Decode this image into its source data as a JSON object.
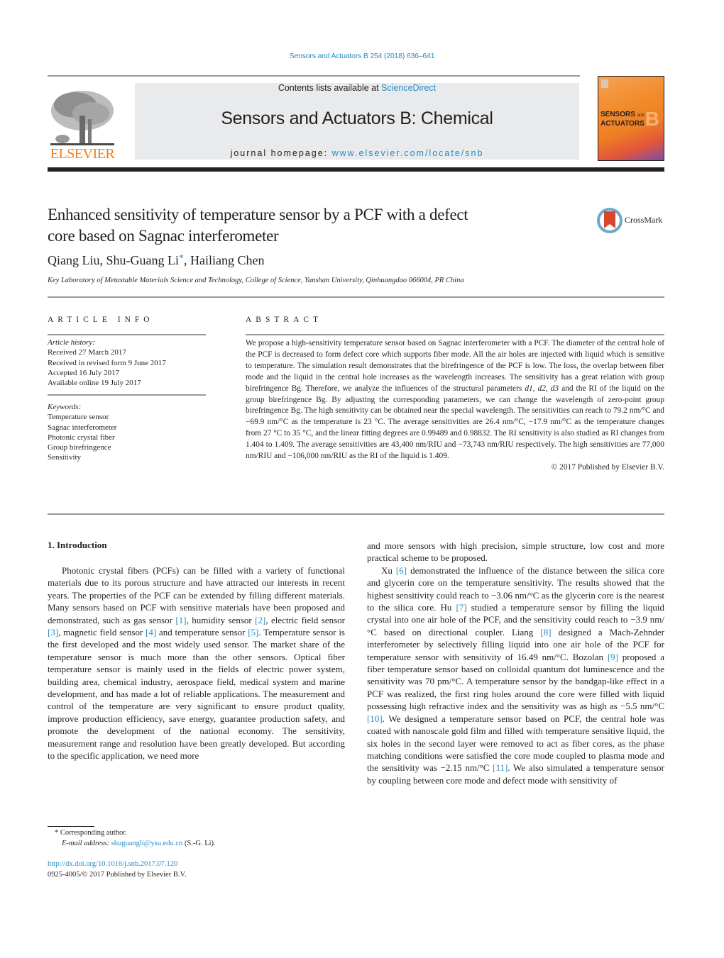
{
  "header": {
    "citation": "Sensors and Actuators B 254 (2018) 636–641",
    "contents_prefix": "Contents lists available at ",
    "contents_link": "ScienceDirect",
    "journal_title": "Sensors and Actuators B: Chemical",
    "homepage_prefix": "journal homepage: ",
    "homepage_link": "www.elsevier.com/locate/snb",
    "publisher_logo_text": "ELSEVIER",
    "cover": {
      "line1": "SENSORS",
      "and": "and",
      "line2": "ACTUATORS",
      "letter": "B"
    },
    "colors": {
      "link": "#2a8cc3",
      "elsevier_orange": "#f07d1a",
      "masthead_bg": "#e9eaeb"
    }
  },
  "article": {
    "title_line1": "Enhanced sensitivity of temperature sensor by a PCF with a defect",
    "title_line2": "core based on Sagnac interferometer",
    "crossmark_label": "CrossMark",
    "authors": {
      "a1": "Qiang Liu, Shu-Guang Li",
      "star": "*",
      "a2": ", Hailiang Chen"
    },
    "affiliation": "Key Laboratory of Metastable Materials Science and Technology, College of Science, Yanshan University, Qinhuangdao 066004, PR China"
  },
  "article_info": {
    "heading": "ARTICLE INFO",
    "history_label": "Article history:",
    "history": [
      "Received 27 March 2017",
      "Received in revised form 9 June 2017",
      "Accepted 16 July 2017",
      "Available online 19 July 2017"
    ],
    "keywords_label": "Keywords:",
    "keywords": [
      "Temperature sensor",
      "Sagnac interferometer",
      "Photonic crystal fiber",
      "Group birefringence",
      "Sensitivity"
    ]
  },
  "abstract": {
    "heading": "ABSTRACT",
    "text_a": "We propose a high-sensitivity temperature sensor based on Sagnac interferometer with a PCF. The diameter of the central hole of the PCF is decreased to form defect core which supports fiber mode. All the air holes are injected with liquid which is sensitive to temperature. The simulation result demonstrates that the birefringence of the PCF is low. The loss, the overlap between fiber mode and the liquid in the central hole increases as the wavelength increases. The sensitivity has a great relation with group birefringence Bg. Therefore, we analyze the influences of the structural parameters ",
    "vars": "d1, d2, d3",
    "text_b": " and the RI of the liquid on the group birefringence Bg. By adjusting the corresponding parameters, we can change the wavelength of zero-point group birefringence Bg. The high sensitivity can be obtained near the special wavelength. The sensitivities can reach to 79.2 nm/°C and −69.9 nm/°C as the temperature is 23 °C. The average sensitivities are 26.4 nm/°C, −17.9 nm/°C as the temperature changes from 27 °C to 35 °C, and the linear fitting degrees are 0.99489 and 0.98832. The RI sensitivity is also studied as RI changes from 1.404 to 1.409. The average sensitivities are 43,400 nm/RIU and −73,743 nm/RIU respectively. The high sensitivities are 77,000 nm/RIU and −106,000 nm/RIU as the RI of the liquid is 1.409.",
    "copyright": "© 2017 Published by Elsevier B.V."
  },
  "body": {
    "section_title": "1.  Introduction",
    "left": {
      "p1_a": "Photonic crystal fibers (PCFs) can be filled with a variety of functional materials due to its porous structure and have attracted our interests in recent years. The properties of the PCF can be extended by filling different materials. Many sensors based on PCF with sensitive materials have been proposed and demonstrated, such as gas sensor ",
      "r1": "[1]",
      "p1_b": ", humidity sensor ",
      "r2": "[2]",
      "p1_c": ", electric field sensor ",
      "r3": "[3]",
      "p1_d": ", magnetic field sensor ",
      "r4": "[4]",
      "p1_e": " and temperature sensor ",
      "r5": "[5]",
      "p1_f": ". Temperature sensor is the first developed and the most widely used sensor. The market share of the temperature sensor is much more than the other sensors. Optical fiber temperature sensor is mainly used in the fields of electric power system, building area, chemical industry, aerospace field, medical system and marine development, and has made a lot of reliable applications. The measurement and control of the temperature are very significant to ensure product quality, improve production efficiency, save energy, guarantee production safety, and promote the development of the national economy. The sensitivity, measurement range and resolution have been greatly developed. But according to the specific application, we need more"
    },
    "right": {
      "p1": "and more sensors with high precision, simple structure, low cost and more practical scheme to be proposed.",
      "p2_a": "Xu ",
      "r6": "[6]",
      "p2_b": " demonstrated the influence of the distance between the silica core and glycerin core on the temperature sensitivity. The results showed that the highest sensitivity could reach to −3.06 nm/°C as the glycerin core is the nearest to the silica core. Hu ",
      "r7": "[7]",
      "p2_c": " studied a temperature sensor by filling the liquid crystal into one air hole of the PCF, and the sensitivity could reach to −3.9 nm/°C based on directional coupler. Liang ",
      "r8": "[8]",
      "p2_d": " designed a Mach-Zehnder interferometer by selectively filling liquid into one air hole of the PCF for temperature sensor with sensitivity of 16.49 nm/°C. Bozolan ",
      "r9": "[9]",
      "p2_e": " proposed a fiber temperature sensor based on colloidal quantum dot luminescence and the sensitivity was 70 pm/°C. A temperature sensor by the bandgap-like effect in a PCF was realized, the first ring holes around the core were filled with liquid possessing high refractive index and the sensitivity was as high as −5.5 nm/°C ",
      "r10": "[10]",
      "p2_f": ". We designed a temperature sensor based on PCF, the central hole was coated with nanoscale gold film and filled with temperature sensitive liquid, the six holes in the second layer were removed to act as fiber cores, as the phase matching conditions were satisfied the core mode coupled to plasma mode and the sensitivity was −2.15 nm/°C ",
      "r11": "[11]",
      "p2_g": ". We also simulated a temperature sensor by coupling between core mode and defect mode with sensitivity of"
    }
  },
  "footer": {
    "star": "*",
    "corresponding": " Corresponding author.",
    "email_label": "E-mail address:",
    "email": "shuguangli@ysu.edu.cn",
    "email_suffix": " (S.-G. Li).",
    "doi": "http://dx.doi.org/10.1016/j.snb.2017.07.120",
    "issn": "0925-4005/© 2017 Published by Elsevier B.V."
  }
}
